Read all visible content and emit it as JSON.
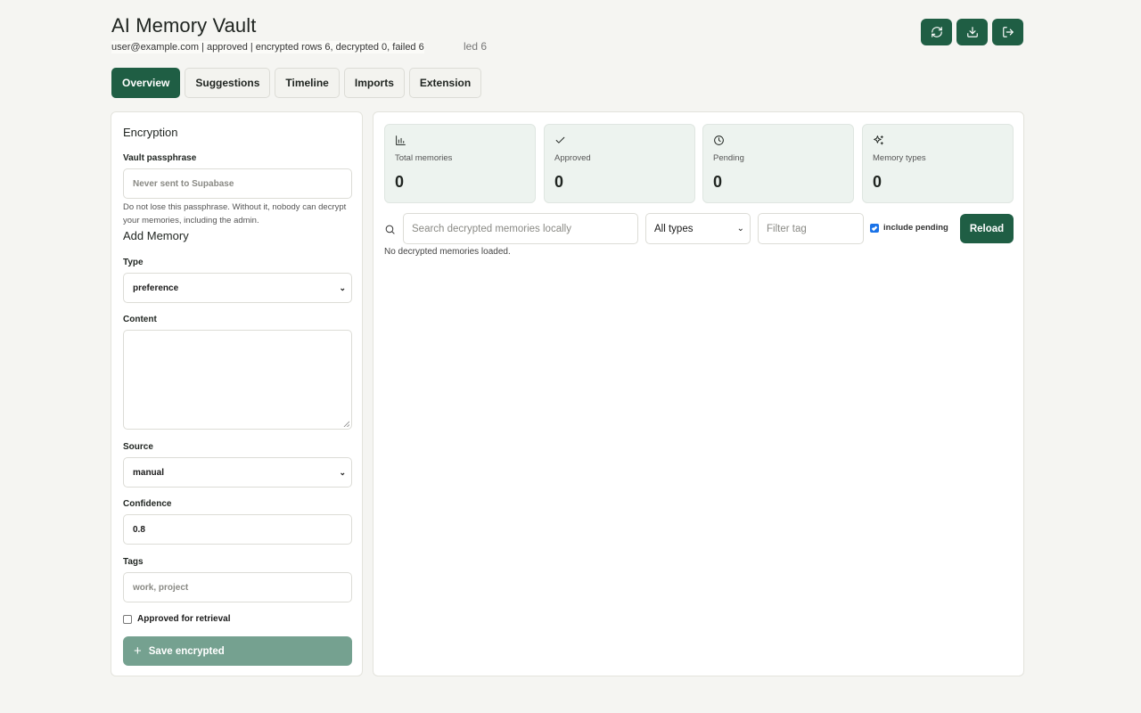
{
  "header": {
    "title": "AI Memory Vault",
    "status": "user@example.com | approved | encrypted rows 6, decrypted 0, failed 6",
    "status_ghost": "led 6"
  },
  "top_actions": [
    {
      "icon": "refresh-icon"
    },
    {
      "icon": "download-icon"
    },
    {
      "icon": "logout-icon"
    }
  ],
  "tabs": [
    {
      "label": "Overview",
      "active": true
    },
    {
      "label": "Suggestions"
    },
    {
      "label": "Timeline"
    },
    {
      "label": "Imports"
    },
    {
      "label": "Extension"
    }
  ],
  "encryption": {
    "title": "Encryption",
    "passphrase_label": "Vault passphrase",
    "passphrase_placeholder": "Never sent to Supabase",
    "hint": "Do not lose this passphrase. Without it, nobody can decrypt your memories, including the admin."
  },
  "add_memory": {
    "title": "Add Memory",
    "type_label": "Type",
    "type_value": "preference",
    "content_label": "Content",
    "content_value": "",
    "source_label": "Source",
    "source_value": "manual",
    "confidence_label": "Confidence",
    "confidence_value": "0.8",
    "tags_label": "Tags",
    "tags_placeholder": "work, project",
    "approved_label": "Approved for retrieval",
    "approved_checked": false,
    "save_label": "Save encrypted"
  },
  "stats": [
    {
      "icon": "bar-chart-icon",
      "label": "Total memories",
      "value": "0"
    },
    {
      "icon": "check-icon",
      "label": "Approved",
      "value": "0"
    },
    {
      "icon": "clock-icon",
      "label": "Pending",
      "value": "0"
    },
    {
      "icon": "sparkles-icon",
      "label": "Memory types",
      "value": "0"
    }
  ],
  "filters": {
    "search_placeholder": "Search decrypted memories locally",
    "type_value": "All types",
    "tag_placeholder": "Filter tag",
    "include_pending_label": "include pending",
    "include_pending_checked": true,
    "reload_label": "Reload"
  },
  "empty_message": "No decrypted memories loaded.",
  "colors": {
    "accent": "#1f5e44",
    "accent_disabled": "#75a190",
    "card_bg": "#edf3ef",
    "page_bg": "#f5f5f2"
  }
}
